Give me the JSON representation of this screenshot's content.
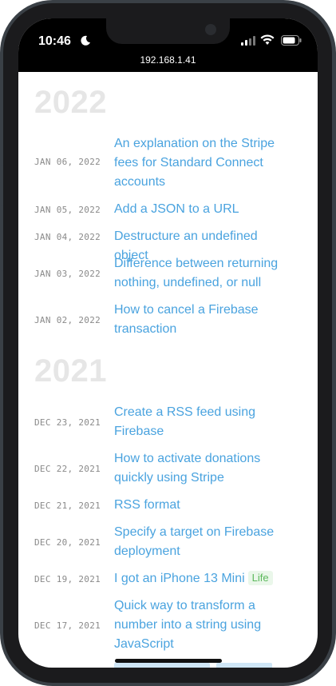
{
  "status_bar": {
    "time": "10:46",
    "url": "192.168.1.41"
  },
  "sections": [
    {
      "year": "2022",
      "posts": [
        {
          "date": "JAN 06, 2022",
          "title": "An explanation on the Stripe fees for Standard Connect accounts"
        },
        {
          "date": "JAN 05, 2022",
          "title": "Add a JSON to a URL"
        },
        {
          "date": "JAN 04, 2022",
          "title": "Destructure an undefined object"
        },
        {
          "date": "JAN 03, 2022",
          "title": "Difference between returning nothing, undefined, or null"
        },
        {
          "date": "JAN 02, 2022",
          "title": "How to cancel a Firebase transaction"
        }
      ]
    },
    {
      "year": "2021",
      "posts": [
        {
          "date": "DEC 23, 2021",
          "title": "Create a RSS feed using Firebase"
        },
        {
          "date": "DEC 22, 2021",
          "title": "How to activate donations quickly using Stripe"
        },
        {
          "date": "DEC 21, 2021",
          "title": "RSS format"
        },
        {
          "date": "DEC 20, 2021",
          "title": "Specify a target on Firebase deployment"
        },
        {
          "date": "DEC 19, 2021",
          "title": "I got an iPhone 13 Mini",
          "tag": "Life"
        },
        {
          "date": "DEC 17, 2021",
          "title": "Quick way to transform a number into a string using JavaScript"
        }
      ]
    }
  ],
  "colors": {
    "link": "#4aa3df",
    "year": "#e6e6e6",
    "date": "#8a8a8a",
    "tag_bg": "#eaf7ea",
    "tag_text": "#5cb85c"
  }
}
